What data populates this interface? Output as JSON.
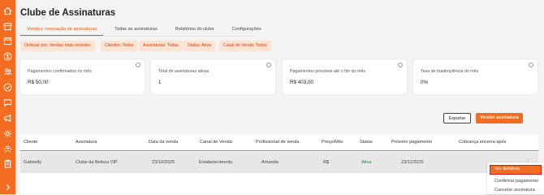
{
  "sidebar": {
    "icons": [
      "home-icon",
      "store-icon",
      "calendar-icon",
      "dollar-icon",
      "users-icon",
      "check-icon",
      "chat-icon",
      "megaphone-icon",
      "settings-icon",
      "group-icon",
      "clipboard-icon",
      "expand-icon"
    ]
  },
  "page": {
    "title": "Clube de Assinaturas"
  },
  "tabs": [
    {
      "label": "Venda e renovação de assinaturas"
    },
    {
      "label": "Todas as assinaturas"
    },
    {
      "label": "Relatórios do clube"
    },
    {
      "label": "Configurações"
    }
  ],
  "filters": [
    {
      "label": "Ordenar por: Vendas mais recentes"
    },
    {
      "label": "Clientes: Todos"
    },
    {
      "label": "Assinaturas: Todas"
    },
    {
      "label": "Status: Ativa"
    },
    {
      "label": "Canal de Venda: Todos"
    }
  ],
  "cards": [
    {
      "label": "Pagamentos confirmados no mês",
      "value": "R$ 50,00"
    },
    {
      "label": "Total de assinaturas ativas",
      "value": "1"
    },
    {
      "label": "Pagamentos previstos até o fim do mês",
      "value": "R$ 403,00"
    },
    {
      "label": "Taxa de inadimplência do mês",
      "value": "0%"
    }
  ],
  "actions": {
    "export_label": "Exportar",
    "sell_label": "Vender assinatura"
  },
  "table": {
    "headers": [
      "Cliente",
      "Assinatura",
      "Data da venda",
      "Canal de Venda",
      "Profissional de venda",
      "Preço/Mês",
      "Status",
      "Próximo pagamento",
      "Cobrança encerra após"
    ],
    "row": {
      "cliente": "Gabrielly",
      "assinatura": "Clube da Beleza VIP",
      "data": "23/10/2025",
      "canal": "Estabelecimento",
      "profissional": "Amanda",
      "preco": "R$",
      "status": "Ativa",
      "proximo": "23/11/2025"
    }
  },
  "context_menu": {
    "items": [
      "Ver detalhes",
      "Confirmar pagamento",
      "Cancelar assinatura"
    ]
  },
  "colors": {
    "accent": "#f26c22",
    "status_active": "#1b8a3a",
    "highlight": "#d01f1f"
  }
}
